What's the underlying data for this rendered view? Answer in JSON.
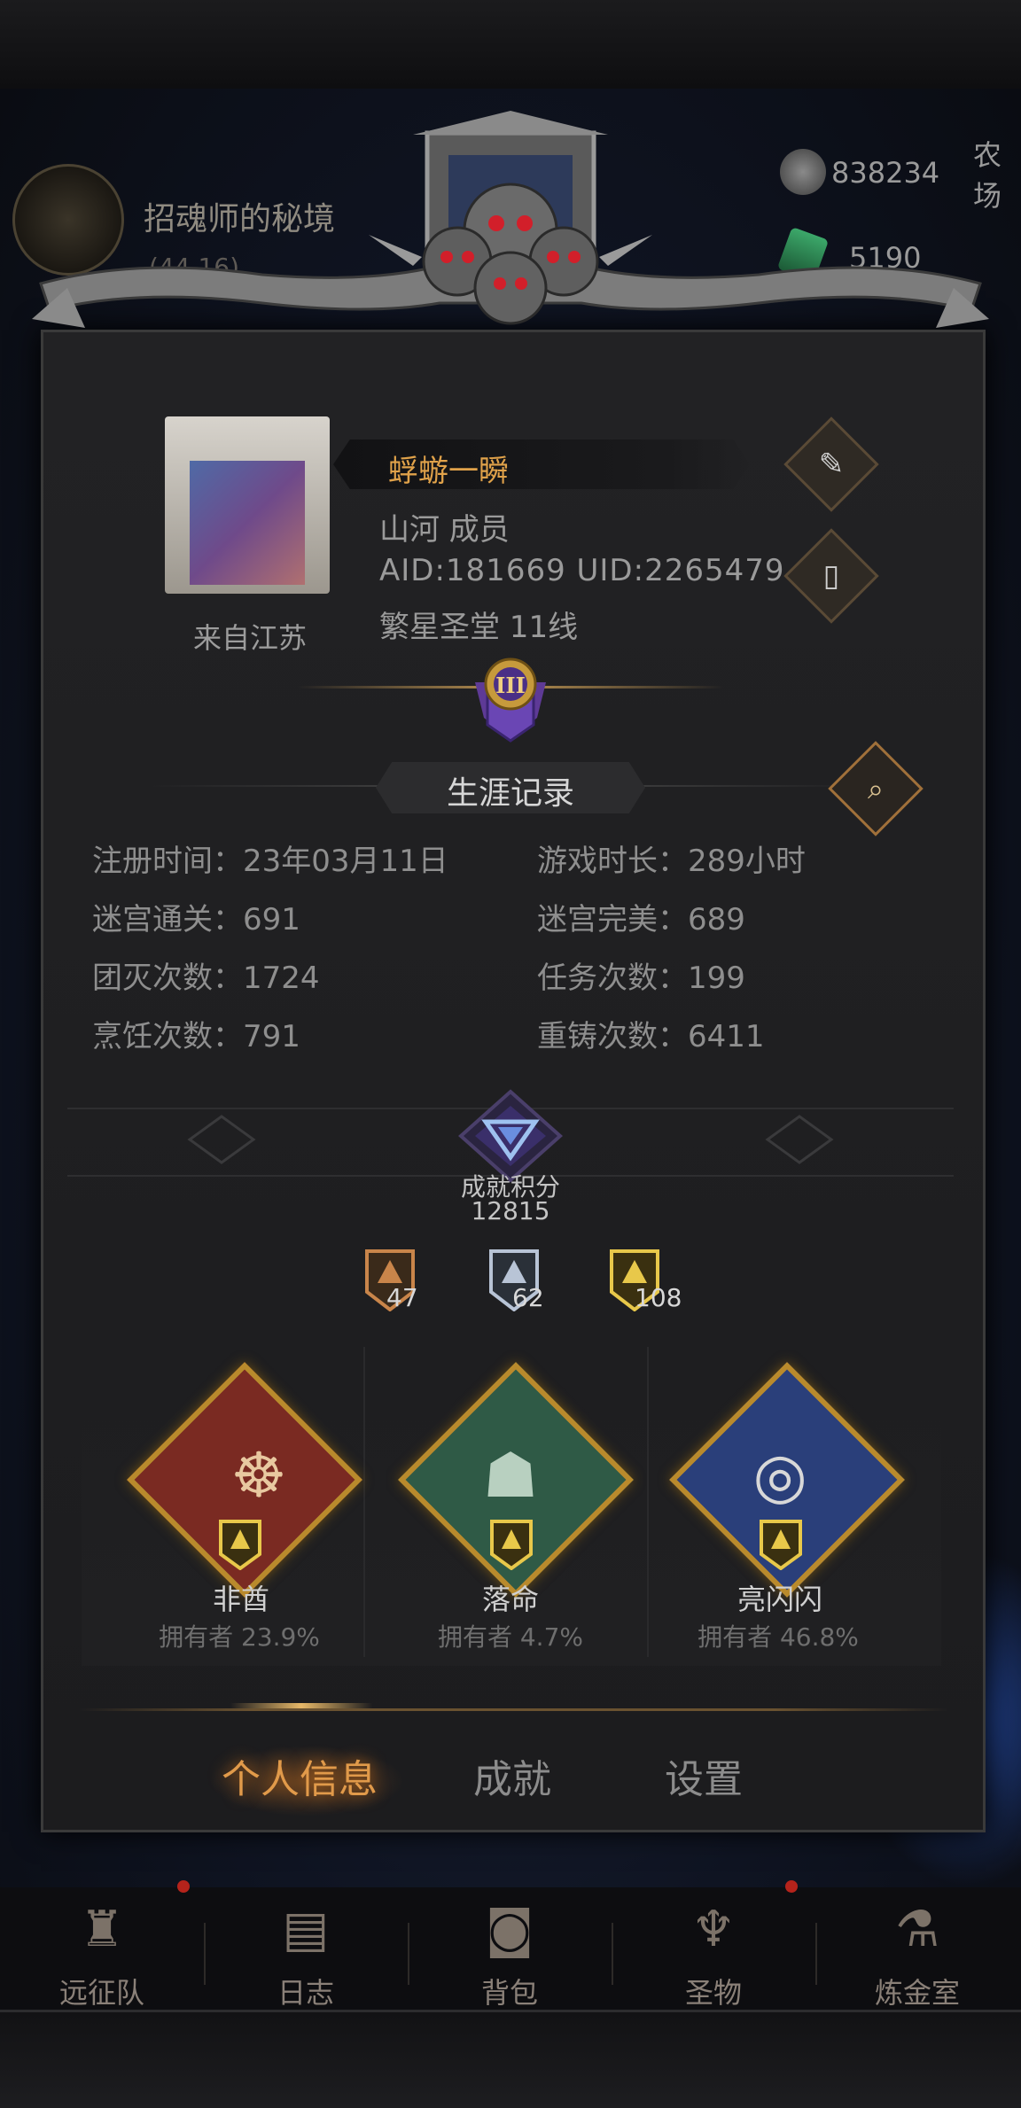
{
  "map": {
    "zone_title": "招魂师的秘境",
    "zone_coords": "(44,16)",
    "resources": [
      {
        "icon": "silver-ore-icon",
        "value": "838234"
      },
      {
        "icon": "emerald-gem-icon",
        "value": "5190"
      }
    ],
    "farm_label": "农场"
  },
  "profile": {
    "name": "蜉蝣一瞬",
    "guild_line": "山河  成员",
    "ids_line": "AID:181669 UID:2265479",
    "server_line": "繁星圣堂  11线",
    "from_label": "来自江苏",
    "rank_roman": "III"
  },
  "career": {
    "title": "生涯记录",
    "stats": [
      {
        "label": "注册时间：23年03月11日"
      },
      {
        "label": "游戏时长：289小时"
      },
      {
        "label": "迷宫通关：691"
      },
      {
        "label": "迷宫完美：689"
      },
      {
        "label": "团灭次数：1724"
      },
      {
        "label": "任务次数：199"
      },
      {
        "label": "烹饪次数：791"
      },
      {
        "label": "重铸次数：6411"
      }
    ]
  },
  "achievement": {
    "label": "成就积分",
    "score": "12815",
    "medals": [
      {
        "tier": "bronze",
        "count": "47",
        "color": "#c9854a"
      },
      {
        "tier": "silver",
        "count": "62",
        "color": "#b8c4d6"
      },
      {
        "tier": "gold",
        "count": "108",
        "color": "#e8c84a"
      }
    ],
    "featured": [
      {
        "name": "非酋",
        "owners": "拥有者 23.9%",
        "icon": "tribal-chief-icon",
        "color": "#7a2a22"
      },
      {
        "name": "落命",
        "owners": "拥有者 4.7%",
        "icon": "tombstone-icon",
        "color": "#2f5a46"
      },
      {
        "name": "亮闪闪",
        "owners": "拥有者 46.8%",
        "icon": "silver-coins-icon",
        "color": "#2a3f7a"
      }
    ]
  },
  "tabs": [
    {
      "label": "个人信息",
      "active": true
    },
    {
      "label": "成就",
      "active": false
    },
    {
      "label": "设置",
      "active": false
    }
  ],
  "nav": [
    {
      "label": "远征队",
      "icon": "horned-helmet-icon",
      "glyph": "♜"
    },
    {
      "label": "日志",
      "icon": "journal-icon",
      "glyph": "▤"
    },
    {
      "label": "背包",
      "icon": "backpack-icon",
      "glyph": "◙"
    },
    {
      "label": "圣物",
      "icon": "relic-chalice-icon",
      "glyph": "♆"
    },
    {
      "label": "炼金室",
      "icon": "alchemy-icon",
      "glyph": "⚗"
    }
  ],
  "colors": {
    "accent_orange": "#e19a4a",
    "gold": "#b98a2c",
    "panel": "#1e1e20"
  }
}
